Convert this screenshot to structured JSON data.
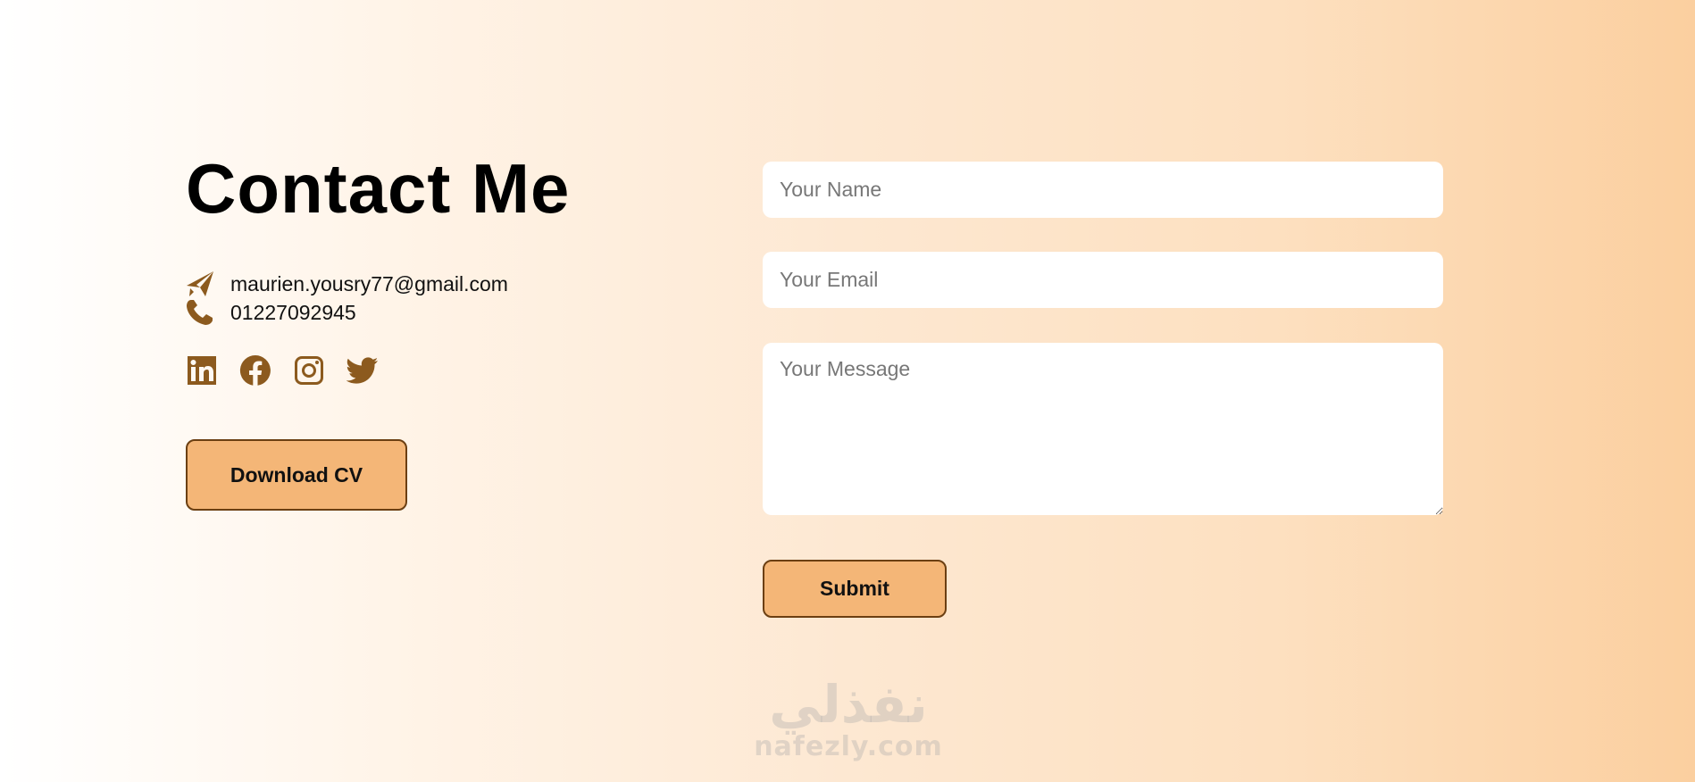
{
  "page_title": "Contact Me",
  "contact": {
    "email": "maurien.yousry77@gmail.com",
    "phone": "01227092945"
  },
  "icons": {
    "email": "paper-plane-icon",
    "phone": "phone-icon",
    "socials": [
      "linkedin-icon",
      "facebook-icon",
      "instagram-icon",
      "twitter-icon"
    ]
  },
  "cv_button": "Download CV",
  "form": {
    "name_placeholder": "Your Name",
    "email_placeholder": "Your Email",
    "message_placeholder": "Your Message",
    "submit_label": "Submit"
  },
  "watermark": {
    "arabic": "نفذلي",
    "latin": "nafezly.com"
  },
  "colors": {
    "accent": "#f4b677",
    "icon": "#8c5a1e",
    "border": "#6b3f12"
  }
}
